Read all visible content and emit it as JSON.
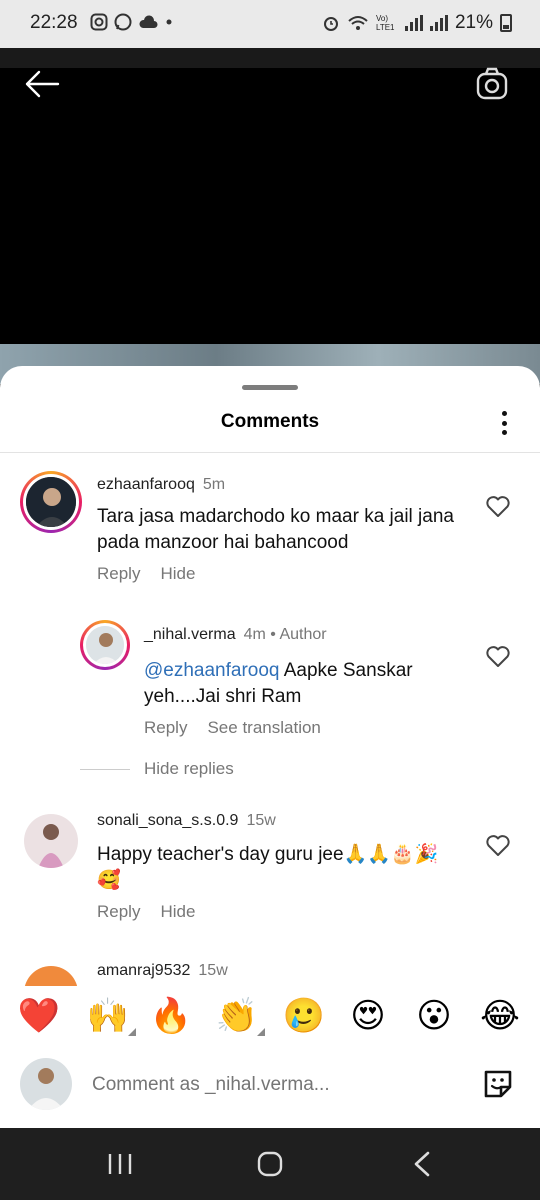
{
  "status_bar": {
    "time": "22:28",
    "battery": "21%",
    "network": "Vo) LTE1"
  },
  "sheet": {
    "title": "Comments"
  },
  "comments": [
    {
      "username": "ezhaanfarooq",
      "time": "5m",
      "text": "Tara jasa madarchodo ko maar ka jail jana pada manzoor hai bahancood",
      "reply_label": "Reply",
      "hide_label": "Hide"
    },
    {
      "username": "_nihal.verma",
      "time": "4m",
      "separator": "•",
      "author_badge": "Author",
      "mention": "@ezhaanfarooq",
      "text": " Aapke Sanskar yeh....Jai shri Ram",
      "reply_label": "Reply",
      "translation_label": "See translation"
    },
    {
      "username": "sonali_sona_s.s.0.9",
      "time": "15w",
      "text": "Happy teacher's day guru jee🙏🙏🎂🎉🥰",
      "reply_label": "Reply",
      "hide_label": "Hide"
    },
    {
      "username": "amanraj9532",
      "time": "15w"
    }
  ],
  "hide_replies_label": "Hide replies",
  "reactions": [
    "❤️",
    "🙌",
    "🔥",
    "👏",
    "🥲",
    "😍",
    "😮",
    "😂"
  ],
  "composer": {
    "placeholder": "Comment as _nihal.verma..."
  },
  "colors": {
    "mention": "#2f6fb7",
    "muted": "#777777"
  }
}
